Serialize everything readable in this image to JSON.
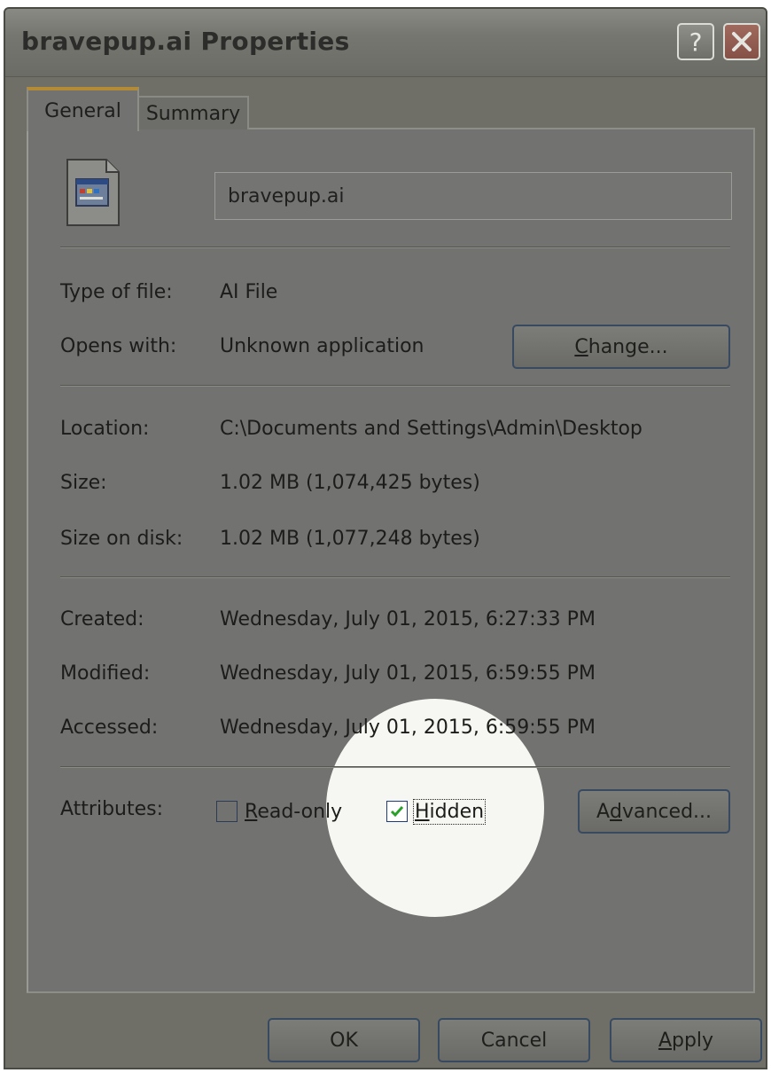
{
  "window": {
    "title": "bravepup.ai Properties",
    "help_glyph": "?",
    "close_glyph": "✕"
  },
  "tabs": [
    {
      "label": "General",
      "active": true
    },
    {
      "label": "Summary",
      "active": false
    }
  ],
  "file": {
    "icon": "ai-file-icon",
    "name": "bravepup.ai"
  },
  "info": {
    "type_label": "Type of file:",
    "type_value": "AI File",
    "opens_label": "Opens with:",
    "opens_value": "Unknown application",
    "change_button": {
      "pre": "",
      "accel": "C",
      "post": "hange..."
    },
    "location_label": "Location:",
    "location_value": "C:\\Documents and Settings\\Admin\\Desktop",
    "size_label": "Size:",
    "size_value": "1.02 MB (1,074,425 bytes)",
    "size_on_disk_label": "Size on disk:",
    "size_on_disk_value": "1.02 MB (1,077,248 bytes)",
    "created_label": "Created:",
    "created_value": "Wednesday, July 01, 2015, 6:27:33 PM",
    "modified_label": "Modified:",
    "modified_value": "Wednesday, July 01, 2015, 6:59:55 PM",
    "accessed_label": "Accessed:",
    "accessed_value": "Wednesday, July 01, 2015, 6:59:55 PM"
  },
  "attributes": {
    "label": "Attributes:",
    "readonly": {
      "accel": "R",
      "post": "ead-only",
      "checked": false
    },
    "hidden": {
      "accel": "H",
      "post": "idden",
      "checked": true
    },
    "advanced_button": {
      "pre": "A",
      "accel": "d",
      "post": "vanced..."
    }
  },
  "footer": {
    "ok": "OK",
    "cancel": "Cancel",
    "apply": {
      "accel": "A",
      "post": "pply"
    }
  },
  "colors": {
    "check_mark": "#2aa02a",
    "close_button": "#855046",
    "button_border": "#384a60"
  }
}
